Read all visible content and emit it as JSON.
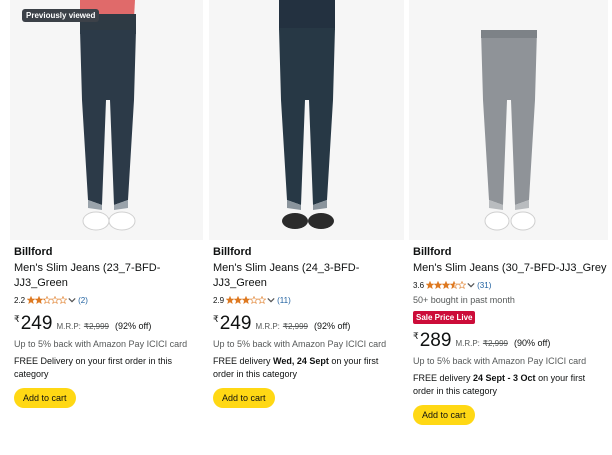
{
  "colors": {
    "accent": "#ffd814",
    "star": "#de7921",
    "link": "#2162a1",
    "deal": "#cc0c39"
  },
  "products": [
    {
      "badge": "Previously viewed",
      "brand": "Billford",
      "title_line1": "Men's Slim Jeans (23_7-BFD-",
      "title_line2": "JJ3_Green",
      "rating": "2.2",
      "rating_stars": 2.2,
      "reviews": "(2)",
      "price_symbol": "₹",
      "price": "249",
      "mrp_label": "M.R.P:",
      "mrp": "₹2,999",
      "discount": "(92% off)",
      "cashback": "Up to 5% back with Amazon Pay ICICI card",
      "delivery_prefix": "FREE Delivery on your first order in this category",
      "delivery_bold": "",
      "delivery_suffix": "",
      "cart_label": "Add to cart",
      "image": "dark-blue-jeans"
    },
    {
      "badge": "",
      "brand": "Billford",
      "title_line1": "Men's Slim Jeans (24_3-BFD-",
      "title_line2": "JJ3_Green",
      "rating": "2.9",
      "rating_stars": 2.9,
      "reviews": "(11)",
      "price_symbol": "₹",
      "price": "249",
      "mrp_label": "M.R.P:",
      "mrp": "₹2,999",
      "discount": "(92% off)",
      "cashback": "Up to 5% back with Amazon Pay ICICI card",
      "delivery_prefix": "FREE delivery ",
      "delivery_bold": "Wed, 24 Sept",
      "delivery_suffix": " on your first order in this category",
      "cart_label": "Add to cart",
      "image": "dark-green-jeans"
    },
    {
      "badge": "",
      "brand": "Billford",
      "title_line1": "Men's Slim Jeans (30_7-BFD-JJ3_Grey",
      "title_line2": "",
      "rating": "3.6",
      "rating_stars": 3.6,
      "reviews": "(31)",
      "bought": "50+ bought in past month",
      "deal_badge": "Sale Price Live",
      "price_symbol": "₹",
      "price": "289",
      "mrp_label": "M.R.P:",
      "mrp": "₹2,999",
      "discount": "(90% off)",
      "cashback": "Up to 5% back with Amazon Pay ICICI card",
      "delivery_prefix": "FREE delivery ",
      "delivery_bold": "24 Sept - 3 Oct",
      "delivery_suffix": " on your first order in this category",
      "cart_label": "Add to cart",
      "image": "grey-jeans"
    }
  ]
}
